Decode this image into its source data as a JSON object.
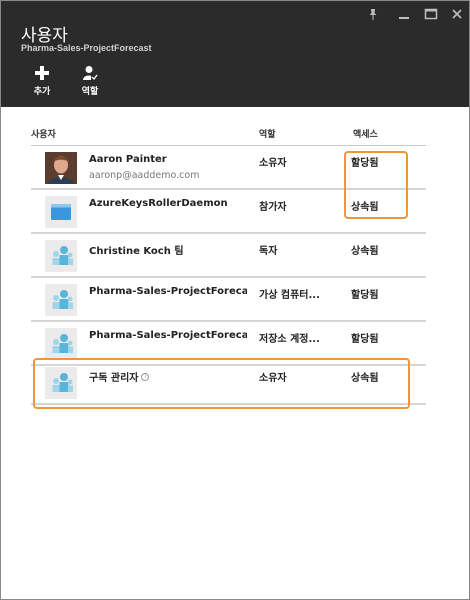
{
  "header": {
    "title": "사용자",
    "subtitle": "Pharma-Sales-ProjectForecast",
    "window_controls": [
      "pin-icon",
      "minimize-icon",
      "maximize-icon",
      "close-icon"
    ]
  },
  "commands": {
    "add_label": "추가",
    "add_icon": "plus-icon",
    "role_label": "역할",
    "role_icon": "user-role-icon"
  },
  "table": {
    "columns": {
      "user": "사용자",
      "role": "역할",
      "access": "액세스"
    },
    "rows": [
      {
        "name": "Aaron Painter",
        "email": "aaronp@aaddemo.com",
        "role": "소유자",
        "access": "할당됨",
        "avatar": "user-photo"
      },
      {
        "name": "AzureKeysRollerDaemon",
        "role": "참가자",
        "access": "상속됨",
        "avatar": "application-icon"
      },
      {
        "name": "Christine Koch 팀",
        "role": "독자",
        "access": "상속됨",
        "avatar": "group-icon"
      },
      {
        "name": "Pharma-Sales-ProjectForecast Co...",
        "role": "가상 컴퓨터...",
        "access": "할당됨",
        "avatar": "group-icon"
      },
      {
        "name": "Pharma-Sales-ProjectForecast Stor...",
        "role": "저장소 계정...",
        "access": "할당됨",
        "avatar": "group-icon"
      },
      {
        "name": "구독 관리자",
        "role": "소유자",
        "access": "상속됨",
        "avatar": "group-icon",
        "info_icon": "info-icon"
      }
    ]
  },
  "colors": {
    "header_bg": "#2b2b2b",
    "highlight": "#f0953a",
    "group_icon_blue": "#59b4d9",
    "app_icon_blue": "#3a96dd"
  }
}
